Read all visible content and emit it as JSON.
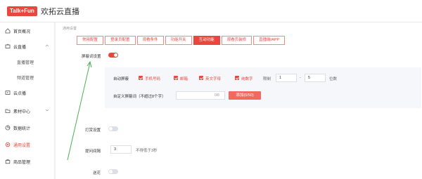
{
  "app": {
    "logo_text": "Talk+Fun",
    "title": "欢拓云直播"
  },
  "sidebar": {
    "items": [
      {
        "label": "首页概况",
        "icon": "home-icon"
      },
      {
        "label": "云直播",
        "icon": "broadcast-icon",
        "expanded": true
      },
      {
        "label": "直播管理",
        "sub": true
      },
      {
        "label": "频道管理",
        "sub": true
      },
      {
        "label": "云点播",
        "icon": "play-icon"
      },
      {
        "label": "素材中心",
        "icon": "folder-icon"
      },
      {
        "label": "数据统计",
        "icon": "chart-icon"
      },
      {
        "label": "通用设置",
        "icon": "settings-icon",
        "active": true
      },
      {
        "label": "商品管理",
        "icon": "shop-icon"
      }
    ]
  },
  "breadcrumb": "通用设置",
  "tabs": [
    {
      "label": "常用配置"
    },
    {
      "label": "登录页配置"
    },
    {
      "label": "观看条件"
    },
    {
      "label": "功能开关"
    },
    {
      "label": "互动功能",
      "active": true
    },
    {
      "label": "观看页装修"
    },
    {
      "label": "直播端/APP"
    }
  ],
  "settings": {
    "block_words_label": "屏蔽词设置",
    "block_words_enabled": true,
    "auto_block_label": "自动屏蔽",
    "checkboxes": [
      "手机号码",
      "邮箱",
      "英文字母",
      "纯数字"
    ],
    "limit_label": "限制",
    "limit_min": "1",
    "limit_sep": "-",
    "limit_max": "5",
    "limit_unit": "位数",
    "custom_label": "自定义屏蔽词（不超过8个字）",
    "custom_value": "",
    "custom_counter": "0/8",
    "add_button": "添加(0/50)",
    "reward_label": "打赏设置",
    "reward_enabled": false,
    "interval_label": "提问间隔",
    "interval_value": "3",
    "interval_hint": "不得低于3秒",
    "flower_label": "送花",
    "flower_enabled": false
  },
  "colors": {
    "accent": "#e8473e",
    "annotation_arrow": "#4caf50"
  }
}
